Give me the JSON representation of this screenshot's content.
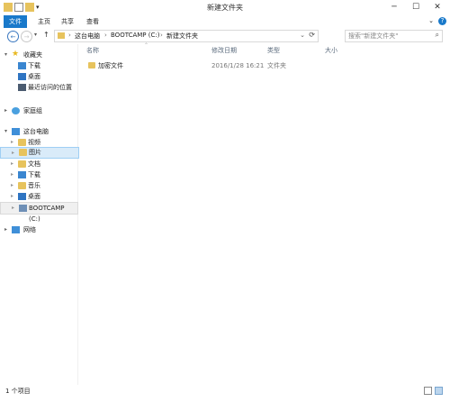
{
  "window": {
    "title": "新建文件夹"
  },
  "ribbon": {
    "tabs": [
      "文件",
      "主页",
      "共享",
      "查看"
    ]
  },
  "address": {
    "crumbs": [
      "这台电脑",
      "BOOTCAMP (C:)",
      "新建文件夹"
    ],
    "search_placeholder": "搜索\"新建文件夹\""
  },
  "nav": {
    "favorites": {
      "label": "收藏夹",
      "items": [
        "下载",
        "桌面",
        "最近访问的位置"
      ]
    },
    "homegroup": "家庭组",
    "thispc": {
      "label": "这台电脑",
      "items": [
        "视频",
        "图片",
        "文档",
        "下载",
        "音乐",
        "桌面",
        "BOOTCAMP (C:)"
      ]
    },
    "network": "网络"
  },
  "columns": {
    "name": "名称",
    "modified": "修改日期",
    "type": "类型",
    "size": "大小"
  },
  "files": [
    {
      "name": "加密文件",
      "modified": "2016/1/28 16:21",
      "type": "文件夹",
      "size": ""
    }
  ],
  "status": {
    "count": "1 个项目"
  },
  "colors": {
    "accent": "#1979ca",
    "folder": "#e7c35d",
    "selection": "#d9ebf9"
  }
}
